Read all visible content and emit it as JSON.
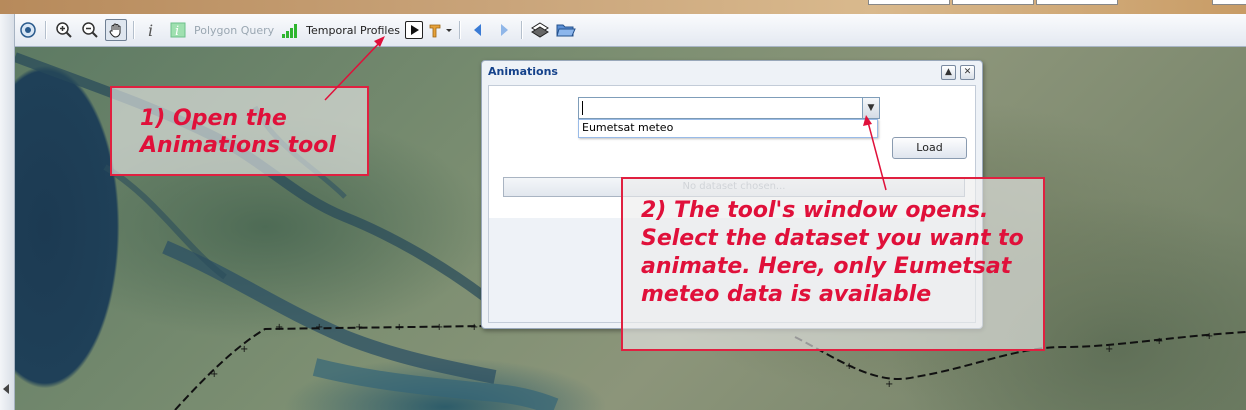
{
  "toolbar": {
    "polygon_query_label": "Polygon Query",
    "temporal_profiles_label": "Temporal Profiles"
  },
  "animations_window": {
    "title": "Animations",
    "dataset_combo_value": "",
    "dataset_options": [
      "Eumetsat meteo"
    ],
    "load_label": "Load",
    "progress_text": "No dataset chosen..."
  },
  "annotations": {
    "step1": "1) Open the Animations tool",
    "step2": "2) The tool's window opens. Select the dataset you want to animate. Here, only Eumetsat meteo data is available"
  },
  "colors": {
    "annotation_red": "#e0103a",
    "title_blue": "#15428b"
  }
}
